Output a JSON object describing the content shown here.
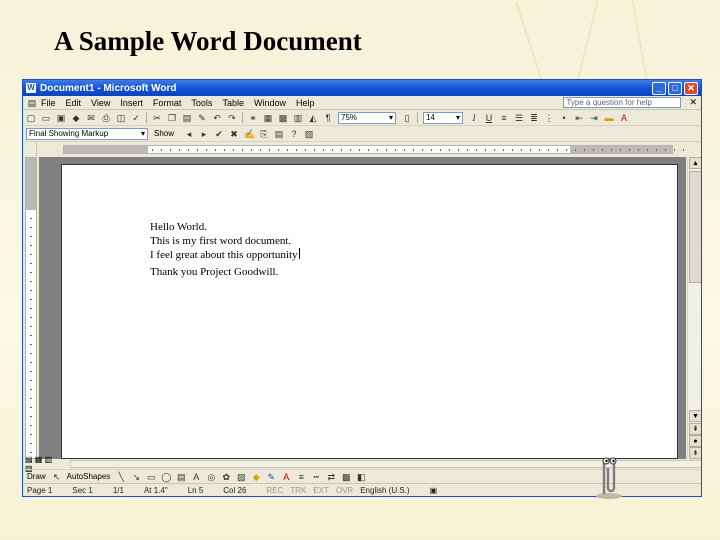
{
  "slide": {
    "title": "A Sample Word Document"
  },
  "window": {
    "title": "Document1 - Microsoft Word",
    "buttons": [
      "_",
      "□",
      "✕"
    ]
  },
  "menubar": {
    "items": [
      "File",
      "Edit",
      "View",
      "Insert",
      "Format",
      "Tools",
      "Table",
      "Window",
      "Help"
    ],
    "help_placeholder": "Type a question for help",
    "close": "✕"
  },
  "toolbar": {
    "zoom": "75%",
    "font_size": "14",
    "markup_mode": "Final Showing Markup",
    "show_label": "Show"
  },
  "document": {
    "lines": [
      "Hello World.",
      "This is my first word document.",
      "I feel great about this opportunity"
    ],
    "last_line": "Thank you Project Goodwill."
  },
  "drawbar": {
    "draw_label": "Draw",
    "autoshapes_label": "AutoShapes"
  },
  "status": {
    "page": "Page 1",
    "section": "Sec 1",
    "page_of": "1/1",
    "at": "At 1.4\"",
    "ln": "Ln 5",
    "col": "Col 26",
    "modes": [
      "REC",
      "TRK",
      "EXT",
      "OVR"
    ],
    "language": "English (U.S.)"
  },
  "icons": [
    "word-app-icon",
    "new-icon",
    "open-icon",
    "save-icon",
    "print-icon",
    "cut-icon",
    "copy-icon",
    "paste-icon",
    "undo-icon",
    "bold-icon",
    "italic-icon",
    "underline-icon",
    "align-left-icon",
    "bullets-icon",
    "font-color-icon",
    "clippy-icon"
  ]
}
